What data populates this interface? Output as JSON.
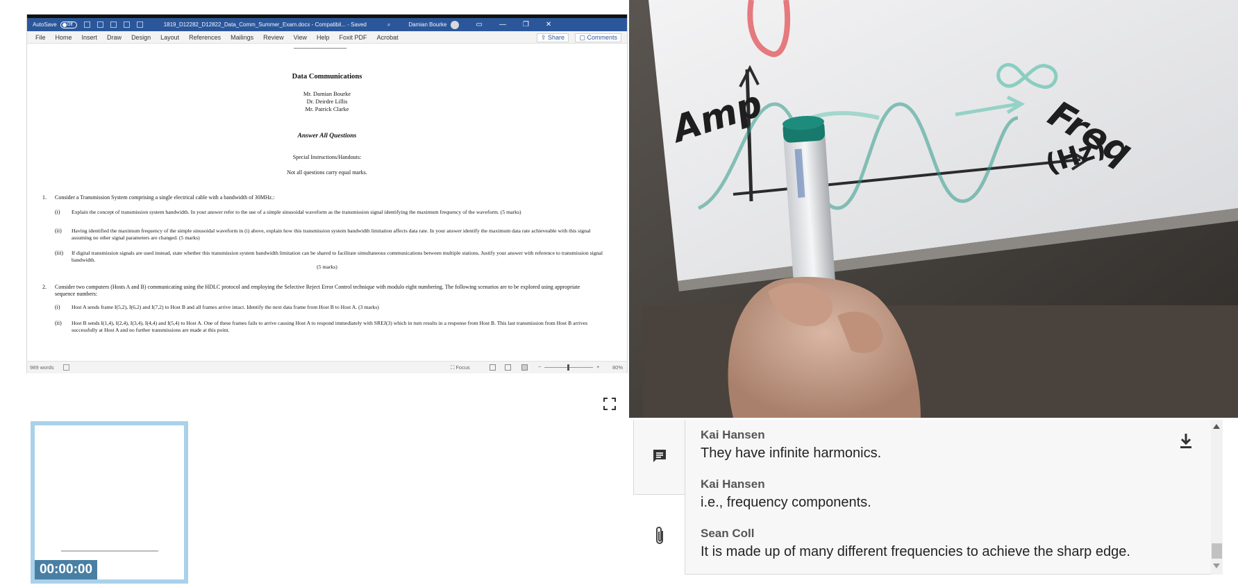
{
  "word": {
    "autosave_label": "AutoSave",
    "autosave_state": "Off",
    "file_title": "1819_D12282_D12822_Data_Comm_Summer_Exam.docx - Compatibil... - Saved",
    "user_name": "Damian Bourke",
    "menu": [
      "File",
      "Home",
      "Insert",
      "Draw",
      "Design",
      "Layout",
      "References",
      "Mailings",
      "Review",
      "View",
      "Help",
      "Foxit PDF",
      "Acrobat"
    ],
    "share_label": "Share",
    "comments_label": "Comments",
    "doc": {
      "title": "Data Communications",
      "authors": [
        "Mr. Damian Bourke",
        "Dr. Deirdre Lillis",
        "Mr. Patrick Clarke"
      ],
      "answer_all": "Answer All Questions",
      "special": "Special Instructions/Handouts:",
      "notall": "Not all questions carry equal marks.",
      "q1_num": "1.",
      "q1": "Consider a Transmission System comprising a single electrical cable with a bandwidth of 30MHz.:",
      "q1_i_num": "(i)",
      "q1_i": "Explain the concept of transmission system bandwidth. In your answer refer to the use of a simple sinusoidal waveform as the transmission signal identifying the maximum frequency of the waveform. (5 marks)",
      "q1_ii_num": "(ii)",
      "q1_ii": "Having identified the maximum frequency of the simple sinusoidal waveform in (i) above, explain how this transmission system bandwidth limitation affects data rate. In your answer identify the maximum data rate achieveable with this signal assuming no other signal parameters are changed. (5 marks)",
      "q1_iii_num": "(iii)",
      "q1_iii": "If digital transmission signals are used instead, state whether this transmission system bandwidth limitation can be shared to facilitate simultaneous communications between multiple stations. Justify your answer with reference to transmission signal bandwidth.",
      "q1_iii_marks": "(5 marks)",
      "q2_num": "2.",
      "q2": "Consider two computers (Hosts A and B) communicating using the HDLC protocol and employing the Selective Reject Error Control technique with modulo eight numbering. The following scenarios are to be explored using appropriate sequence numbers:",
      "q2_i_num": "(i)",
      "q2_i": "Host A sends frame I(5,2), I(6,2) and I(7,2) to Host B and all frames arrive intact. Identify the next data frame from Host B to Host A. (3 marks)",
      "q2_ii_num": "(ii)",
      "q2_ii": "Host B sends I(1,4), I(2,4), I(3,4), I(4,4) and I(5,4) to Host A. One of these frames fails to arrive causing Host A to respond immediately with SREJ(3) which in turn results in a response from Host B. This last transmission from Host B arrives successfully at Host A and no further transmissions are made at this point."
    },
    "status": {
      "word_count": "989 words",
      "focus": "Focus",
      "zoom": "80%"
    }
  },
  "thumbnail": {
    "timer": "00:00:00"
  },
  "chat": {
    "messages": [
      {
        "name": "Kai Hansen",
        "text": "They have infinite harmonics."
      },
      {
        "name": "Kai Hansen",
        "text": "i.e., frequency components."
      },
      {
        "name": "Sean Coll",
        "text": "It is made up of many different frequencies to achieve the sharp edge."
      }
    ]
  },
  "video": {
    "whiteboard_words": [
      "Amp",
      "Freq",
      "(Hz)",
      "∞"
    ]
  },
  "colors": {
    "word_blue": "#2b579a",
    "thumb_border": "#a9d1e9",
    "timer_bg": "#4a7fa4"
  }
}
